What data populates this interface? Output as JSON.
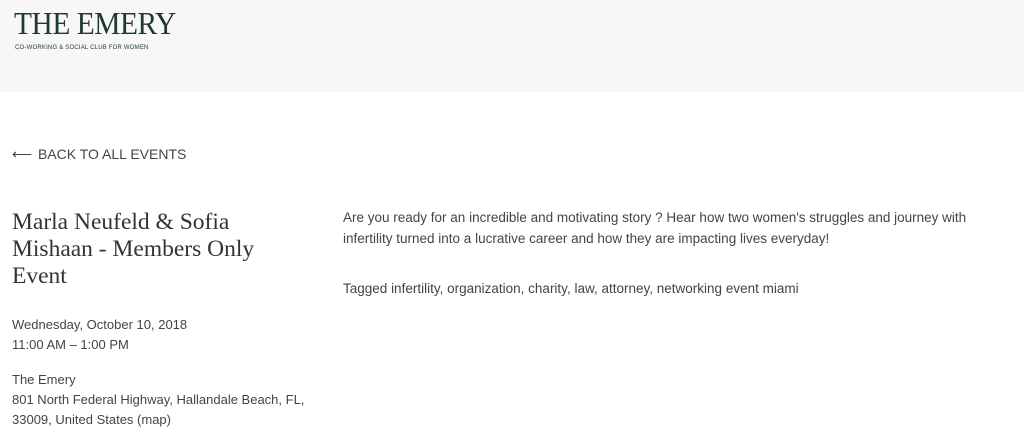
{
  "header": {
    "logo_title": "THE EMERY",
    "logo_subtitle": "CO-WORKING & SOCIAL CLUB FOR WOMEN"
  },
  "nav": {
    "back_arrow": "⟵",
    "back_label": "BACK TO ALL EVENTS"
  },
  "event": {
    "title": "Marla Neufeld & Sofia Mishaan - Members Only Event",
    "date": "Wednesday, October 10, 2018",
    "time": "11:00 AM – 1:00 PM",
    "venue": "The Emery",
    "address_line1": "801 North Federal Highway, Hallandale Beach, FL,",
    "address_line2": "33009, United States",
    "map_label": "(map)",
    "description": "Are you ready for an incredible and motivating story ? Hear how two women's struggles and journey with infertility turned into a lucrative career and how they are impacting lives everyday!",
    "tags_prefix": "Tagged",
    "tags": [
      "infertility",
      "organization",
      "charity",
      "law",
      "attorney",
      "networking event miami"
    ]
  },
  "colors": {
    "brand": "#1f3a2b",
    "header_bg": "#f7f7f7",
    "text": "#444444"
  }
}
